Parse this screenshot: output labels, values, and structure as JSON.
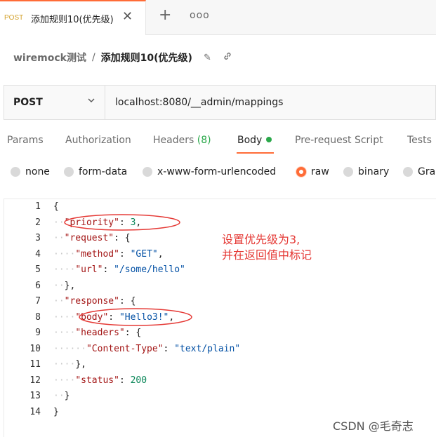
{
  "tab": {
    "method": "POST",
    "title": "添加规则10(优先级)",
    "close_icon": "close-icon",
    "new_tab_icon": "plus-icon",
    "more_icon": "more-horizontal-icon"
  },
  "breadcrumb": {
    "collection": "wiremock测试",
    "separator": "/",
    "request": "添加规则10(优先级)",
    "edit_icon": "pencil-icon",
    "link_icon": "link-icon"
  },
  "url_bar": {
    "method": "POST",
    "url": "localhost:8080/__admin/mappings"
  },
  "request_tabs": [
    {
      "label": "Params"
    },
    {
      "label": "Authorization"
    },
    {
      "label": "Headers",
      "count": "(8)"
    },
    {
      "label": "Body",
      "active": true
    },
    {
      "label": "Pre-request Script"
    },
    {
      "label": "Tests"
    }
  ],
  "body_types": [
    {
      "label": "none"
    },
    {
      "label": "form-data"
    },
    {
      "label": "x-www-form-urlencoded"
    },
    {
      "label": "raw",
      "selected": true
    },
    {
      "label": "binary"
    },
    {
      "label": "Gra"
    }
  ],
  "editor": {
    "line_numbers": [
      "1",
      "2",
      "3",
      "4",
      "5",
      "6",
      "7",
      "8",
      "9",
      "10",
      "11",
      "12",
      "13",
      "14"
    ],
    "lines": [
      [
        [
          "p",
          "{"
        ]
      ],
      [
        [
          "ws",
          "··"
        ],
        [
          "k",
          "\"priority\""
        ],
        [
          "p",
          ": "
        ],
        [
          "n",
          "3"
        ],
        [
          "p",
          ","
        ]
      ],
      [
        [
          "ws",
          "··"
        ],
        [
          "k",
          "\"request\""
        ],
        [
          "p",
          ": {"
        ]
      ],
      [
        [
          "ws",
          "····"
        ],
        [
          "k",
          "\"method\""
        ],
        [
          "p",
          ": "
        ],
        [
          "s",
          "\"GET\""
        ],
        [
          "p",
          ","
        ]
      ],
      [
        [
          "ws",
          "····"
        ],
        [
          "k",
          "\"url\""
        ],
        [
          "p",
          ": "
        ],
        [
          "s",
          "\"/some/hello\""
        ]
      ],
      [
        [
          "ws",
          "··"
        ],
        [
          "p",
          "},"
        ]
      ],
      [
        [
          "ws",
          "··"
        ],
        [
          "k",
          "\"response\""
        ],
        [
          "p",
          ": {"
        ]
      ],
      [
        [
          "ws",
          "····"
        ],
        [
          "k",
          "\"body\""
        ],
        [
          "p",
          ": "
        ],
        [
          "s",
          "\"Hello3!\""
        ],
        [
          "p",
          ","
        ]
      ],
      [
        [
          "ws",
          "····"
        ],
        [
          "k",
          "\"headers\""
        ],
        [
          "p",
          ": {"
        ]
      ],
      [
        [
          "ws",
          "······"
        ],
        [
          "k",
          "\"Content-Type\""
        ],
        [
          "p",
          ": "
        ],
        [
          "s",
          "\"text/plain\""
        ]
      ],
      [
        [
          "ws",
          "····"
        ],
        [
          "p",
          "},"
        ]
      ],
      [
        [
          "ws",
          "····"
        ],
        [
          "k",
          "\"status\""
        ],
        [
          "p",
          ": "
        ],
        [
          "n",
          "200"
        ]
      ],
      [
        [
          "ws",
          "··"
        ],
        [
          "p",
          "}"
        ]
      ],
      [
        [
          "p",
          "}"
        ]
      ]
    ]
  },
  "annotation": {
    "line1": "设置优先级为3,",
    "line2": "并在返回值中标记",
    "color": "#e53935"
  },
  "watermark": "CSDN @毛奇志",
  "colors": {
    "accent": "#ff6c37",
    "status_green": "#2aa84a",
    "json_key": "#a31515",
    "json_string": "#0451a5",
    "json_number": "#098658"
  }
}
